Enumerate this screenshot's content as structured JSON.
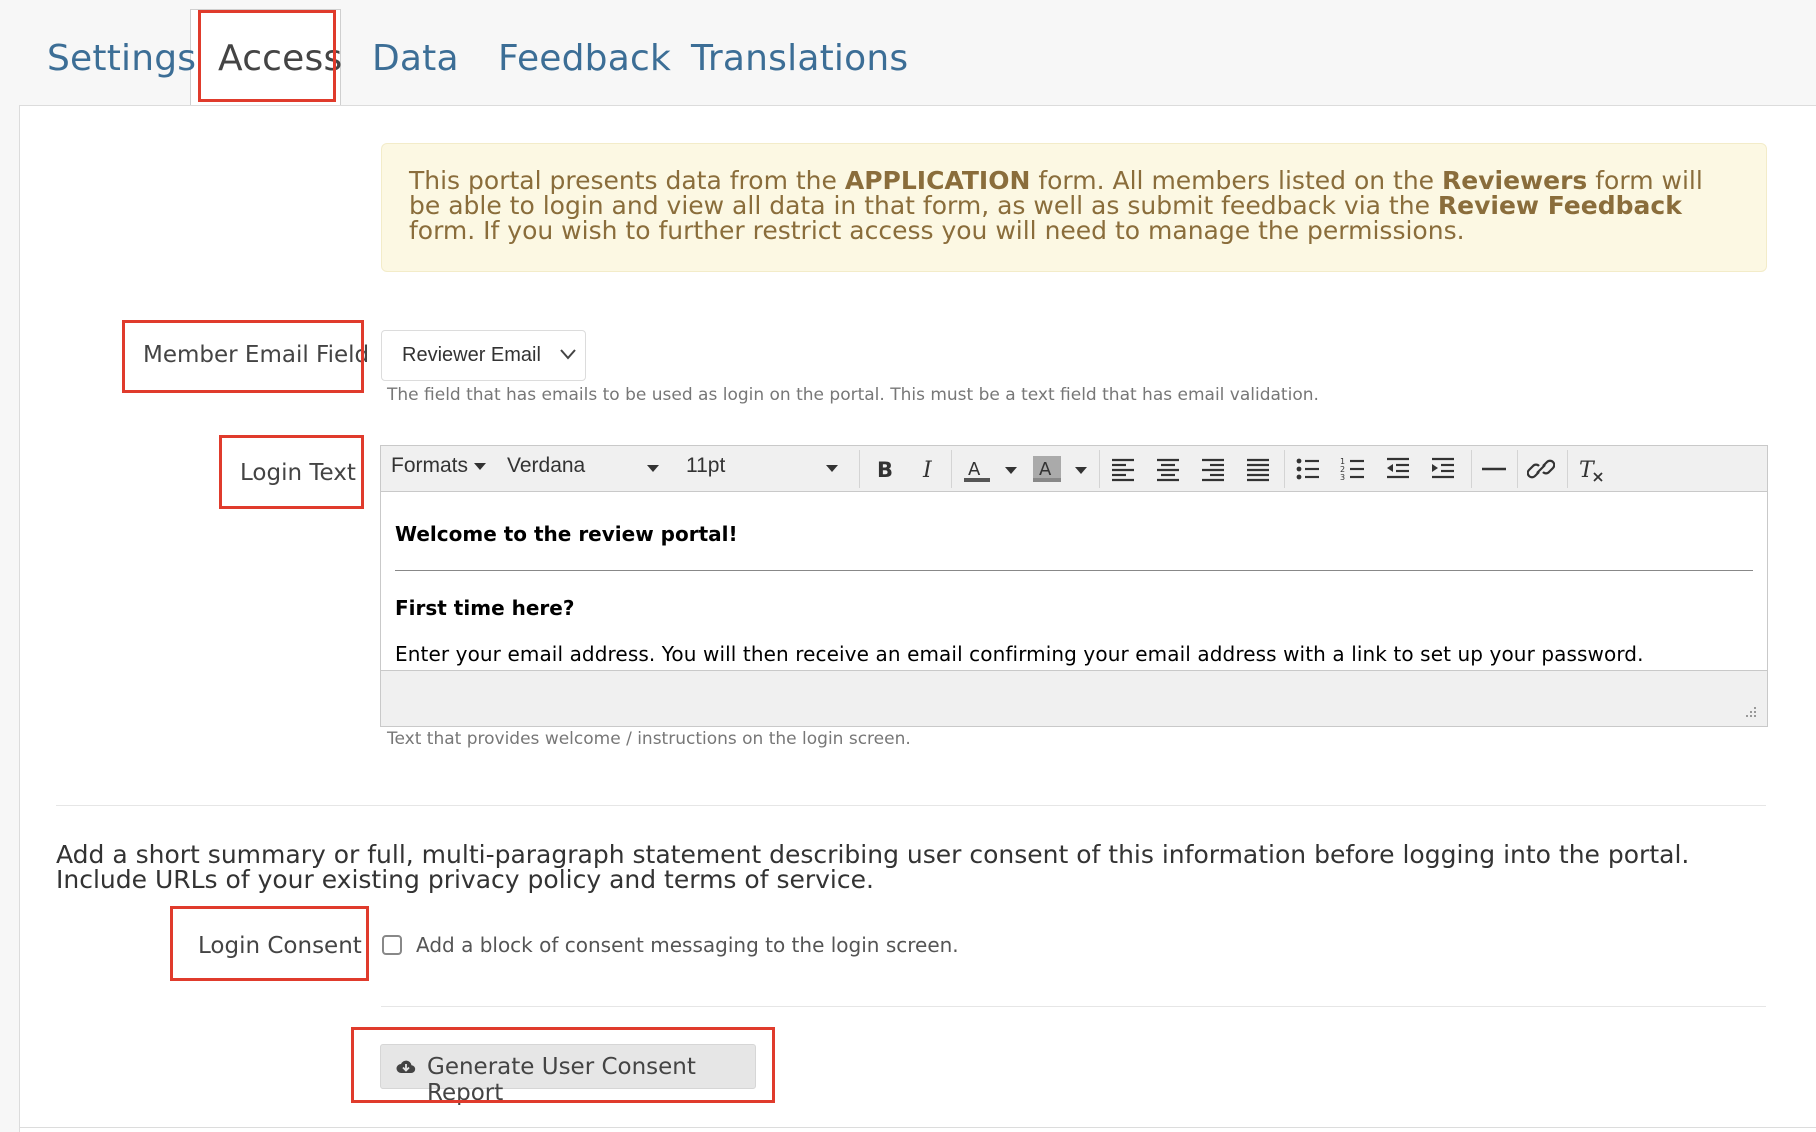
{
  "tabs": [
    {
      "label": "Settings"
    },
    {
      "label": "Access"
    },
    {
      "label": "Data"
    },
    {
      "label": "Feedback"
    },
    {
      "label": "Translations"
    }
  ],
  "active_tab": "Access",
  "notice": {
    "p1": "This portal presents data from the ",
    "form1": "APPLICATION",
    "p2": " form. All members listed on the ",
    "form2": "Reviewers",
    "p3": " form will be able to login and view all data in that form, as well as submit feedback via the ",
    "form3": "Review Feedback",
    "p4": " form. If you wish to further restrict access you will need to manage the permissions."
  },
  "member_email": {
    "label": "Member Email Field",
    "value": "Reviewer Email",
    "help": "The field that has emails to be used as login on the portal. This must be a text field that has email validation."
  },
  "login_text": {
    "label": "Login Text",
    "toolbar": {
      "formats": "Formats",
      "font": "Verdana",
      "size": "11pt"
    },
    "content": {
      "heading": "Welcome to the review portal!",
      "subheading": "First time here?",
      "body": "Enter your email address. You will then receive an email confirming your email address with a link to set up your password."
    },
    "help": "Text that provides welcome / instructions on the login screen."
  },
  "consent_description": "Add a short summary or full, multi-paragraph statement describing user consent of this information before logging into the portal. Include URLs of your existing privacy policy and terms of service.",
  "login_consent": {
    "label": "Login Consent",
    "checkbox_label": "Add a block of consent messaging to the login screen.",
    "checked": false
  },
  "report_button": "Generate User Consent Report",
  "colors": {
    "annotation": "#e03b2c",
    "tab_link": "#3c6e96",
    "notice_bg": "#fcf8e3",
    "notice_text": "#8a6d3b"
  }
}
